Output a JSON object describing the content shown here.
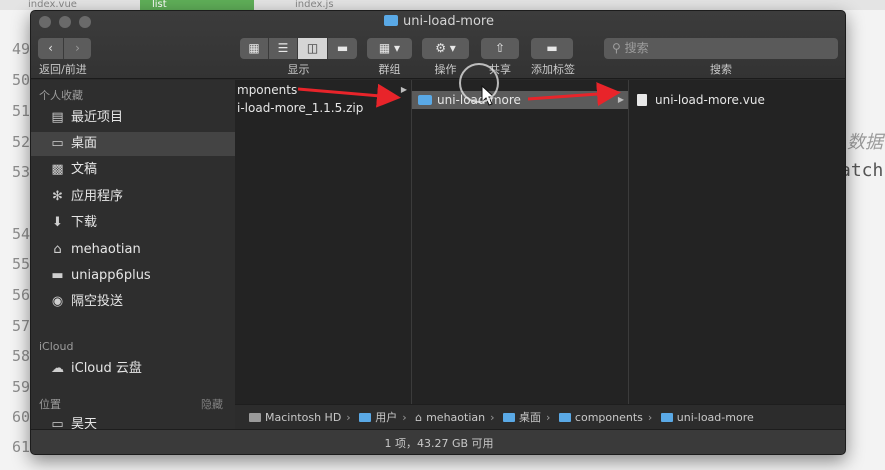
{
  "editor": {
    "tabs": [
      "index.vue",
      "list",
      "index.js"
    ],
    "line_numbers": [
      "49",
      "50",
      "51",
      "52",
      "53",
      "54",
      "55",
      "56",
      "57",
      "58",
      "59",
      "60",
      "61"
    ],
    "fragments": {
      "right_1": "数据",
      "right_2": "atch"
    }
  },
  "window": {
    "title": "uni-load-more",
    "toolbar": {
      "back_forward_label": "返回/前进",
      "view_label": "显示",
      "group_label": "群组",
      "action_label": "操作",
      "share_label": "共享",
      "tag_label": "添加标签",
      "search_label": "搜索",
      "search_placeholder": "搜索"
    },
    "sidebar": {
      "favorites_header": "个人收藏",
      "favorites": [
        {
          "label": "最近项目",
          "icon": "recents-icon"
        },
        {
          "label": "桌面",
          "icon": "desktop-icon"
        },
        {
          "label": "文稿",
          "icon": "documents-icon"
        },
        {
          "label": "应用程序",
          "icon": "applications-icon"
        },
        {
          "label": "下载",
          "icon": "downloads-icon"
        },
        {
          "label": "mehaotian",
          "icon": "home-icon"
        },
        {
          "label": "uniapp6plus",
          "icon": "folder-icon"
        },
        {
          "label": "隔空投送",
          "icon": "airdrop-icon"
        }
      ],
      "icloud_header": "iCloud",
      "icloud": [
        {
          "label": "iCloud 云盘",
          "icon": "cloud-icon"
        }
      ],
      "locations_header": "位置",
      "locations_hide": "隐藏",
      "locations": [
        {
          "label": "昊天",
          "icon": "computer-icon"
        }
      ]
    },
    "columns": {
      "col1": [
        "mponents",
        "i-load-more_1.1.5.zip"
      ],
      "col2": [
        "uni-load-more"
      ],
      "col3": [
        "uni-load-more.vue"
      ]
    },
    "pathbar": [
      "Macintosh HD",
      "用户",
      "mehaotian",
      "桌面",
      "components",
      "uni-load-more"
    ],
    "status": "1 项，43.27 GB 可用"
  }
}
